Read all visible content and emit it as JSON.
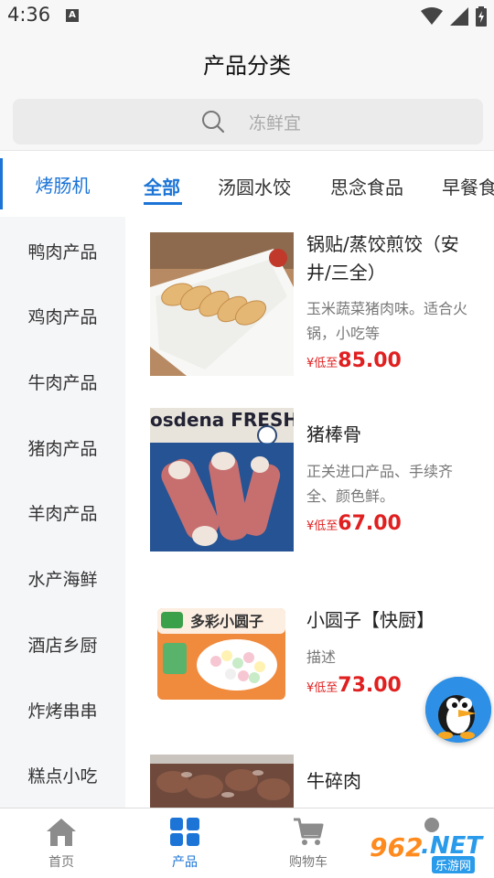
{
  "status_bar": {
    "time": "4:36"
  },
  "header": {
    "title": "产品分类"
  },
  "search": {
    "placeholder": "冻鲜宜"
  },
  "left_category": {
    "label": "烤肠机"
  },
  "tabs": [
    {
      "label": "全部",
      "active": true
    },
    {
      "label": "汤圆水饺"
    },
    {
      "label": "思念食品"
    },
    {
      "label": "早餐食"
    }
  ],
  "sidebar": {
    "items": [
      {
        "label": "鸭肉产品"
      },
      {
        "label": "鸡肉产品"
      },
      {
        "label": "牛肉产品"
      },
      {
        "label": "猪肉产品"
      },
      {
        "label": "羊肉产品"
      },
      {
        "label": "水产海鲜"
      },
      {
        "label": "酒店乡厨"
      },
      {
        "label": "炸烤串串"
      },
      {
        "label": "糕点小吃"
      }
    ]
  },
  "products": [
    {
      "name": "锅贴/蒸饺煎饺（安井/三全）",
      "desc": "玉米蔬菜猪肉味。适合火锅，小吃等",
      "price_prefix": "¥低至",
      "price": "85.00"
    },
    {
      "name": "猪棒骨",
      "desc": "正关进口产品、手续齐全、颜色鲜。",
      "price_prefix": "¥低至",
      "price": "67.00",
      "package_text": "osdena FRESH MEATS"
    },
    {
      "name": "小圆子【快厨】",
      "desc": "描述",
      "price_prefix": "¥低至",
      "price": "73.00",
      "package_text": "多彩小圆子"
    },
    {
      "name": "牛碎肉"
    }
  ],
  "bottom_nav": [
    {
      "label": "首页"
    },
    {
      "label": "产品",
      "active": true
    },
    {
      "label": "购物车"
    },
    {
      "label": ""
    }
  ],
  "watermark": {
    "main": "962",
    "tld": ".NET",
    "sub": "乐游网"
  },
  "colors": {
    "accent": "#1b74d6",
    "price": "#e02020",
    "sidebar_bg": "#f5f6f8",
    "header_bg": "#f7f7f7"
  }
}
